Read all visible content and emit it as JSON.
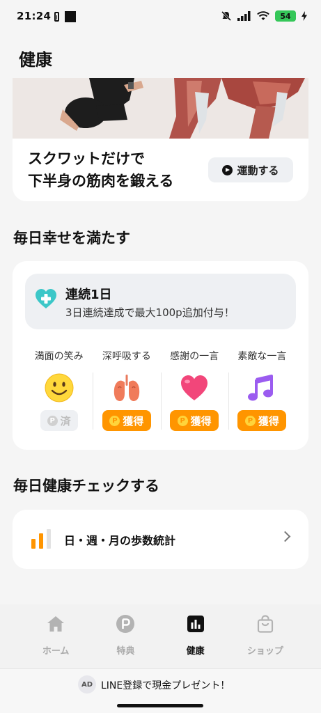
{
  "status_bar": {
    "time": "21:24",
    "battery": "54",
    "icons": [
      "battery-saver-icon",
      "notification-square-icon",
      "mute-icon",
      "signal-icon",
      "wifi-icon",
      "charging-icon"
    ]
  },
  "page": {
    "title": "健康"
  },
  "feature": {
    "line1": "スクワットだけで",
    "line2": "下半身の筋肉を鍛える",
    "button_label": "運動する"
  },
  "happiness": {
    "section_title": "毎日幸せを満たす",
    "streak_title": "連続1日",
    "streak_sub": "3日連続達成で最大100p追加付与！",
    "activities": [
      {
        "label": "満面の笑み",
        "icon": "smile-emoji-icon",
        "button": "済",
        "state": "done"
      },
      {
        "label": "深呼吸する",
        "icon": "lungs-emoji-icon",
        "button": "獲得",
        "state": "earn"
      },
      {
        "label": "感謝の一言",
        "icon": "heart-emoji-icon",
        "button": "獲得",
        "state": "earn"
      },
      {
        "label": "素敵な一言",
        "icon": "music-note-emoji-icon",
        "button": "獲得",
        "state": "earn"
      }
    ],
    "point_symbol": "P"
  },
  "health_check": {
    "section_title": "毎日健康チェックする",
    "steps_label": "日・週・月の歩数統計"
  },
  "nav": {
    "items": [
      {
        "label": "ホーム",
        "icon": "home-icon",
        "active": false
      },
      {
        "label": "特典",
        "icon": "points-icon",
        "active": false
      },
      {
        "label": "健康",
        "icon": "chart-icon",
        "active": true
      },
      {
        "label": "ショップ",
        "icon": "shopping-bag-icon",
        "active": false
      }
    ]
  },
  "ad": {
    "badge": "AD",
    "text": "LINE登録で現金プレゼント！"
  },
  "colors": {
    "accent": "#ff9500",
    "background": "#f5f5f5",
    "card": "#ffffff",
    "battery": "#35c759"
  }
}
